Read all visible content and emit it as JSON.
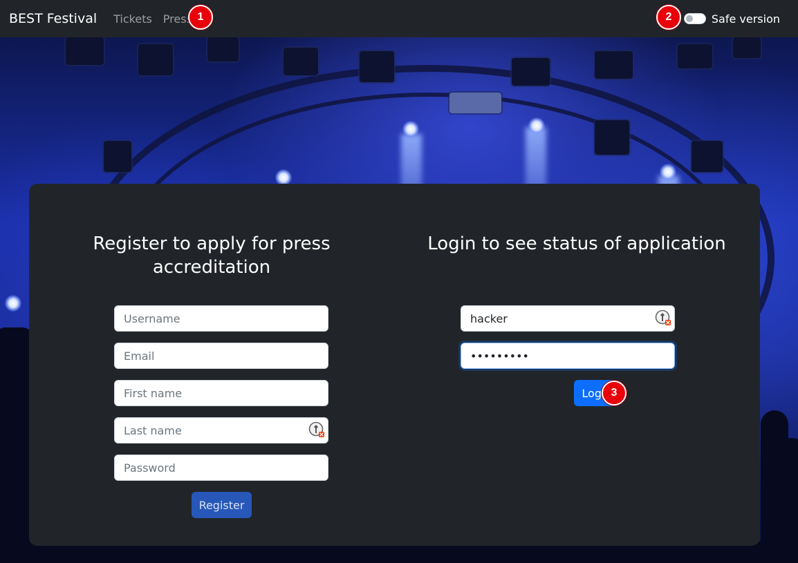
{
  "navbar": {
    "brand": "BEST Festival",
    "links": [
      {
        "label": "Tickets"
      },
      {
        "label": "Press"
      }
    ],
    "toggle": {
      "label": "Safe version",
      "checked": false
    }
  },
  "annotations": [
    "1",
    "2",
    "3"
  ],
  "register": {
    "heading": "Register to apply for press accreditation",
    "fields": {
      "username": {
        "placeholder": "Username",
        "value": ""
      },
      "email": {
        "placeholder": "Email",
        "value": ""
      },
      "first_name": {
        "placeholder": "First name",
        "value": ""
      },
      "last_name": {
        "placeholder": "Last name",
        "value": ""
      },
      "password": {
        "placeholder": "Password",
        "value": ""
      }
    },
    "button_label": "Register"
  },
  "login": {
    "heading": "Login to see status of application",
    "fields": {
      "username": {
        "value": "hacker"
      },
      "password": {
        "value": "•••••••••"
      }
    },
    "button_label": "Login"
  },
  "colors": {
    "navbar_bg": "#212529",
    "card_bg": "#212529",
    "primary": "#0d6efd",
    "badge": "#e8000b"
  },
  "icons": {
    "password_manager": "password-manager-icon"
  }
}
